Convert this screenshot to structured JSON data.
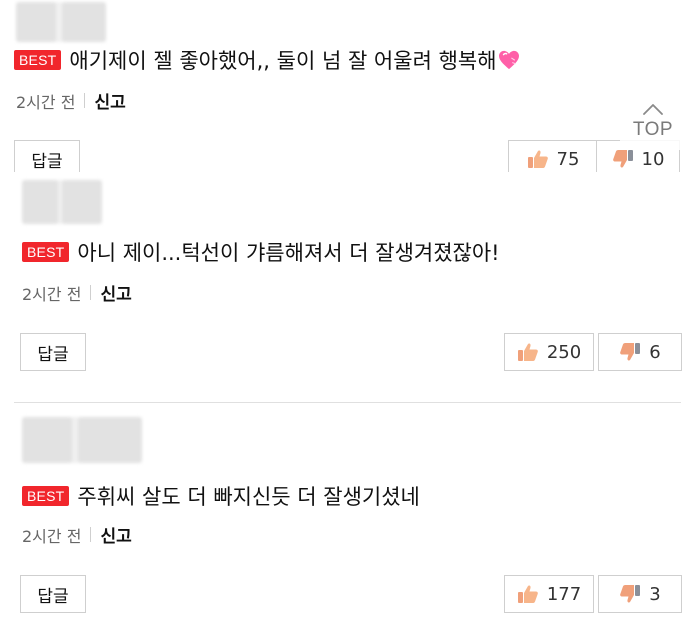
{
  "colors": {
    "best": "#f1262c",
    "border": "#cfcfcf"
  },
  "top_button": {
    "label": "TOP",
    "icon": "chevron-up-icon"
  },
  "comments": [
    {
      "badge": "BEST",
      "text": "애기제이 젤 좋아했어,, 둘이 넘 잘 어울려 행복해",
      "emoji": "heart-icon",
      "time": "2시간 전",
      "report": "신고",
      "reply": "답글",
      "likes": "75",
      "dislikes": "10"
    },
    {
      "badge": "BEST",
      "text": "아니 제이...턱선이 갸름해져서 더 잘생겨졌잖아!",
      "time": "2시간 전",
      "report": "신고",
      "reply": "답글",
      "likes": "250",
      "dislikes": "6"
    },
    {
      "badge": "BEST",
      "text": "주휘씨 살도 더 빠지신듯 더 잘생기셨네",
      "time": "2시간 전",
      "report": "신고",
      "reply": "답글",
      "likes": "177",
      "dislikes": "3"
    }
  ]
}
